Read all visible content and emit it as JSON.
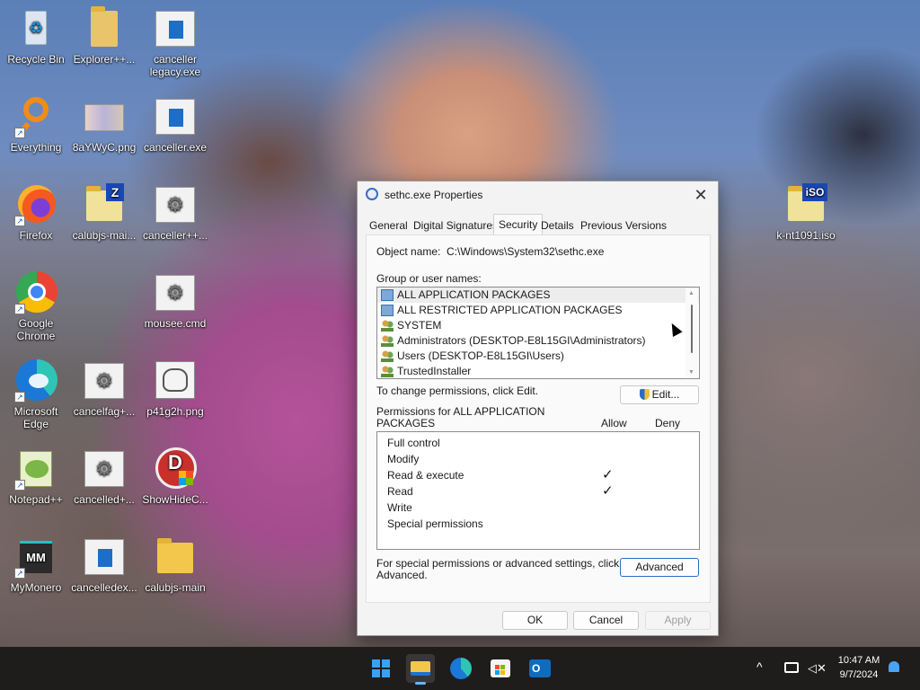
{
  "desktop": {
    "icons": [
      {
        "label": "Recycle Bin",
        "icon": "recycle-bin-icon"
      },
      {
        "label": "Explorer++...",
        "icon": "folder-icon"
      },
      {
        "label": "canceller legacy.exe",
        "icon": "exe-file-icon"
      },
      {
        "label": "Everything",
        "icon": "everything-search-icon"
      },
      {
        "label": "8aYWyC.png",
        "icon": "image-file-icon"
      },
      {
        "label": "canceller.exe",
        "icon": "exe-file-icon"
      },
      {
        "label": "Firefox",
        "icon": "firefox-icon"
      },
      {
        "label": "calubjs-mai...",
        "icon": "zip-folder-icon"
      },
      {
        "label": "canceller++...",
        "icon": "gear-file-icon"
      },
      {
        "label": "k-nt1091.iso",
        "icon": "iso-file-icon"
      },
      {
        "label": "Google Chrome",
        "icon": "chrome-icon"
      },
      {
        "label": "mousee.cmd",
        "icon": "gear-file-icon"
      },
      {
        "label": "Microsoft Edge",
        "icon": "edge-icon"
      },
      {
        "label": "cancelfag+...",
        "icon": "gear-file-icon"
      },
      {
        "label": "p41g2h.png",
        "icon": "image-file-icon"
      },
      {
        "label": "Notepad++",
        "icon": "notepadpp-icon"
      },
      {
        "label": "cancelled+...",
        "icon": "gear-file-icon"
      },
      {
        "label": "ShowHideC...",
        "icon": "showhide-icon"
      },
      {
        "label": "MyMonero",
        "icon": "mymonero-icon"
      },
      {
        "label": "cancelledex...",
        "icon": "exe-file-icon"
      },
      {
        "label": "calubjs-main",
        "icon": "folder-icon"
      }
    ]
  },
  "dialog": {
    "title": "sethc.exe Properties",
    "close_glyph": "✕",
    "tabs": [
      "General",
      "Digital Signatures",
      "Security",
      "Details",
      "Previous Versions"
    ],
    "active_tab": "Security",
    "object_name_label": "Object name:",
    "object_name_value": "C:\\Windows\\System32\\sethc.exe",
    "group_label": "Group or user names:",
    "groups": [
      {
        "name": "ALL APPLICATION PACKAGES",
        "icon": "package-icon"
      },
      {
        "name": "ALL RESTRICTED APPLICATION PACKAGES",
        "icon": "package-icon"
      },
      {
        "name": "SYSTEM",
        "icon": "users-group-icon"
      },
      {
        "name": "Administrators (DESKTOP-E8L15GI\\Administrators)",
        "icon": "users-group-icon"
      },
      {
        "name": "Users (DESKTOP-E8L15GI\\Users)",
        "icon": "users-group-icon"
      },
      {
        "name": "TrustedInstaller",
        "icon": "users-group-icon"
      }
    ],
    "change_hint": "To change permissions, click Edit.",
    "edit_label": "Edit...",
    "perm_header_line1": "Permissions for ALL APPLICATION",
    "perm_header_line2": "PACKAGES",
    "allow_label": "Allow",
    "deny_label": "Deny",
    "check_glyph": "✓",
    "permissions": [
      {
        "name": "Full control",
        "allow": false,
        "deny": false
      },
      {
        "name": "Modify",
        "allow": false,
        "deny": false
      },
      {
        "name": "Read & execute",
        "allow": true,
        "deny": false
      },
      {
        "name": "Read",
        "allow": true,
        "deny": false
      },
      {
        "name": "Write",
        "allow": false,
        "deny": false
      },
      {
        "name": "Special permissions",
        "allow": false,
        "deny": false
      }
    ],
    "advanced_hint_line1": "For special permissions or advanced settings, click",
    "advanced_hint_line2": "Advanced.",
    "advanced_label": "Advanced",
    "ok_label": "OK",
    "cancel_label": "Cancel",
    "apply_label": "Apply"
  },
  "taskbar": {
    "apps": [
      "start-icon",
      "file-explorer-icon",
      "edge-icon",
      "store-icon",
      "outlook-icon"
    ],
    "tray": {
      "chevron": "^",
      "time": "10:47 AM",
      "date": "9/7/2024"
    }
  }
}
